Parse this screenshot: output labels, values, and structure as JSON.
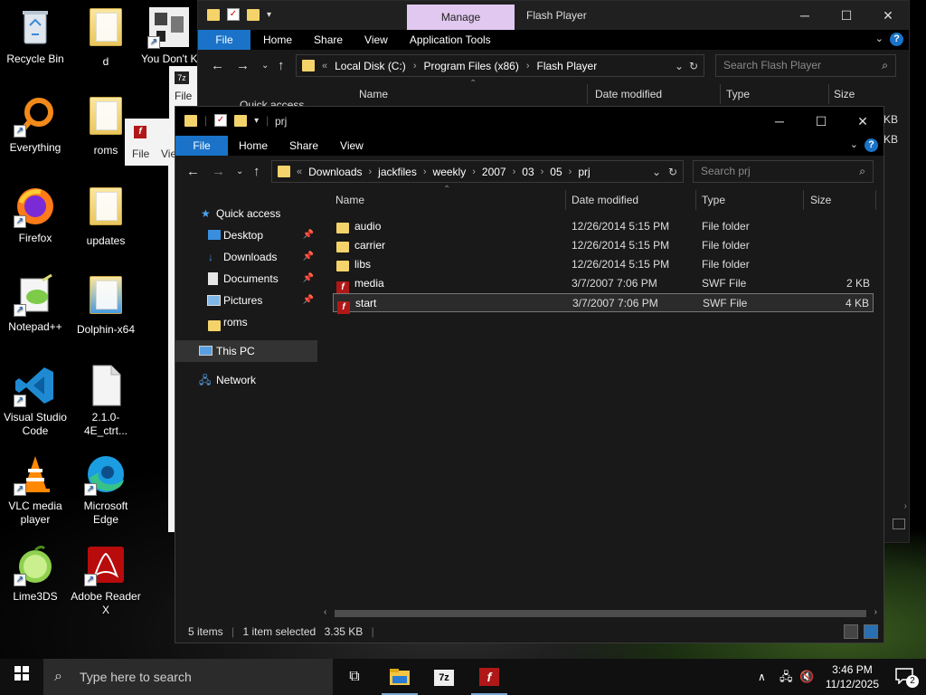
{
  "desktop": {
    "icons": [
      {
        "label": "Recycle Bin",
        "icon": "recycle-bin-icon"
      },
      {
        "label": "d",
        "icon": "folder-icon"
      },
      {
        "label": "You Don't Know",
        "icon": "app-icon"
      },
      {
        "label": "Everything",
        "icon": "everything-icon"
      },
      {
        "label": "roms",
        "icon": "folder-icon"
      },
      {
        "label": "Firefox",
        "icon": "firefox-icon"
      },
      {
        "label": "updates",
        "icon": "folder-icon"
      },
      {
        "label": "Notepad++",
        "icon": "notepadpp-icon"
      },
      {
        "label": "Dolphin-x64",
        "icon": "folder-icon"
      },
      {
        "label": "Visual Studio Code",
        "icon": "vscode-icon"
      },
      {
        "label": "2.1.0-4E_ctrt...",
        "icon": "file-icon"
      },
      {
        "label": "VLC media player",
        "icon": "vlc-icon"
      },
      {
        "label": "Microsoft Edge",
        "icon": "edge-icon"
      },
      {
        "label": "Lime3DS",
        "icon": "lime3ds-icon"
      },
      {
        "label": "Adobe Reader X",
        "icon": "adobe-reader-icon"
      }
    ],
    "partial_windows": {
      "seven_zip_menu": "File",
      "flash_small_menu": "File",
      "flash_small_view": "Vie"
    }
  },
  "back_window": {
    "title": "Flash Player",
    "manage_tab": "Manage",
    "ribbon_tabs": [
      "File",
      "Home",
      "Share",
      "View",
      "Application Tools"
    ],
    "breadcrumb": [
      "Local Disk (C:)",
      "Program Files (x86)",
      "Flash Player"
    ],
    "search_placeholder": "Search Flash Player",
    "columns": [
      "Name",
      "Date modified",
      "Type",
      "Size"
    ],
    "sizes": [
      "KB",
      "KB"
    ],
    "nav_partial": "Quick access"
  },
  "front_window": {
    "title": "prj",
    "ribbon_tabs": [
      "File",
      "Home",
      "Share",
      "View"
    ],
    "breadcrumb": [
      "Downloads",
      "jackfiles",
      "weekly",
      "2007",
      "03",
      "05",
      "prj"
    ],
    "search_placeholder": "Search prj",
    "nav": {
      "quick_access": "Quick access",
      "items": [
        {
          "label": "Desktop",
          "icon": "desktop-icon",
          "pinned": true
        },
        {
          "label": "Downloads",
          "icon": "downloads-icon",
          "pinned": true
        },
        {
          "label": "Documents",
          "icon": "documents-icon",
          "pinned": true
        },
        {
          "label": "Pictures",
          "icon": "pictures-icon",
          "pinned": true
        },
        {
          "label": "roms",
          "icon": "folder-icon",
          "pinned": false
        }
      ],
      "this_pc": "This PC",
      "network": "Network"
    },
    "columns": {
      "name": "Name",
      "date": "Date modified",
      "type": "Type",
      "size": "Size"
    },
    "files": [
      {
        "name": "audio",
        "date": "12/26/2014 5:15 PM",
        "type": "File folder",
        "size": "",
        "icon": "folder-icon"
      },
      {
        "name": "carrier",
        "date": "12/26/2014 5:15 PM",
        "type": "File folder",
        "size": "",
        "icon": "folder-icon"
      },
      {
        "name": "libs",
        "date": "12/26/2014 5:15 PM",
        "type": "File folder",
        "size": "",
        "icon": "folder-icon"
      },
      {
        "name": "media",
        "date": "3/7/2007 7:06 PM",
        "type": "SWF File",
        "size": "2 KB",
        "icon": "swf-icon"
      },
      {
        "name": "start",
        "date": "3/7/2007 7:06 PM",
        "type": "SWF File",
        "size": "4 KB",
        "icon": "swf-icon"
      }
    ],
    "status": {
      "items": "5 items",
      "selected": "1 item selected",
      "size": "3.35 KB"
    }
  },
  "taskbar": {
    "search_placeholder": "Type here to search",
    "time": "3:46 PM",
    "date": "11/12/2025",
    "notifications": "2"
  }
}
